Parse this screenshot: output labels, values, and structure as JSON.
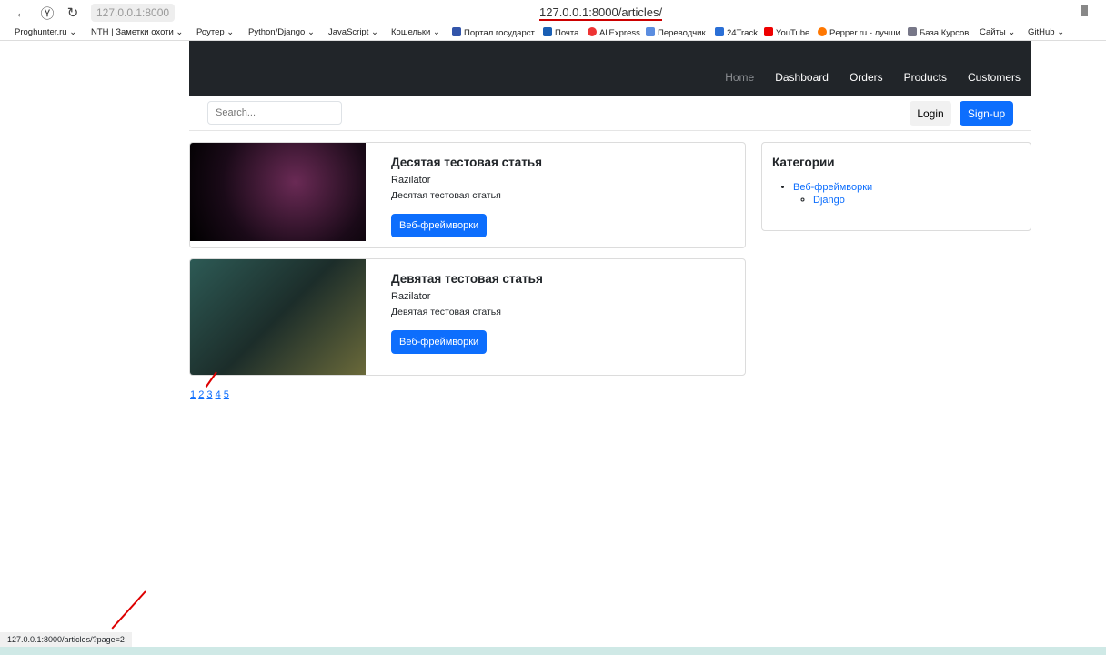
{
  "browser": {
    "address_chip": "127.0.0.1:8000",
    "url": "127.0.0.1:8000/articles/",
    "bookmarks": [
      "Proghunter.ru ⌄",
      "NTH | Заметки охоти ⌄",
      "Роутер ⌄",
      "Python/Django ⌄",
      "JavaScript ⌄",
      "Кошельки ⌄",
      "Портал государст",
      "Почта",
      "AliExpress",
      "Переводчик",
      "24Track",
      "YouTube",
      "Pepper.ru - лучши",
      "База Курсов",
      "Сайты ⌄",
      "GitHub ⌄"
    ],
    "status_url": "127.0.0.1:8000/articles/?page=2"
  },
  "nav": {
    "items": [
      "Home",
      "Dashboard",
      "Orders",
      "Products",
      "Customers"
    ]
  },
  "search": {
    "placeholder": "Search..."
  },
  "auth": {
    "login": "Login",
    "signup": "Sign-up"
  },
  "articles": [
    {
      "title": "Десятая тестовая статья",
      "author": "Razilator",
      "desc": "Десятая тестовая статья",
      "category": "Веб-фреймворки"
    },
    {
      "title": "Девятая тестовая статья",
      "author": "Razilator",
      "desc": "Девятая тестовая статья",
      "category": "Веб-фреймворки"
    }
  ],
  "sidebar": {
    "title": "Категории",
    "category": "Веб-фреймворки",
    "subcategory": "Django"
  },
  "pagination": [
    "1",
    "2",
    "3",
    "4",
    "5"
  ]
}
